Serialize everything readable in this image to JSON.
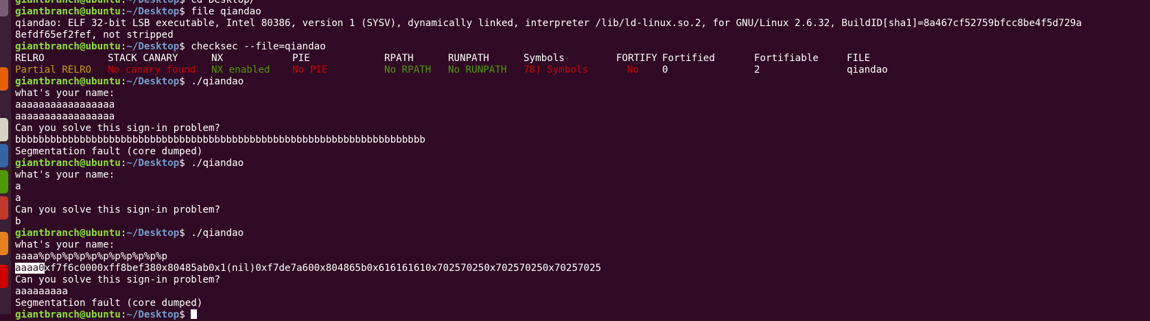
{
  "prompt": {
    "user": "giantbranch@ubuntu",
    "path": "~/Desktop"
  },
  "lines": [
    {
      "kind": "cmd",
      "text": "cd Desktop/"
    },
    {
      "kind": "cmd",
      "text": "file qiandao"
    },
    {
      "kind": "out",
      "text": "qiandao: ELF 32-bit LSB executable, Intel 80386, version 1 (SYSV), dynamically linked, interpreter /lib/ld-linux.so.2, for GNU/Linux 2.6.32, BuildID[sha1]=8a467cf52759bfcc8be4f5d729a"
    },
    {
      "kind": "out",
      "text": "8efdf65ef2fef, not stripped"
    },
    {
      "kind": "cmd",
      "text": "checksec --file=qiandao"
    }
  ],
  "checksec": {
    "headers": [
      "RELRO",
      "STACK CANARY",
      "NX",
      "PIE",
      "RPATH",
      "RUNPATH",
      "Symbols",
      "FORTIFY",
      "Fortified",
      "Fortifiable",
      "FILE"
    ],
    "values": [
      "Partial RELRO",
      "No canary found",
      "NX enabled",
      "No PIE",
      "No RPATH",
      "No RUNPATH",
      "78) Symbols",
      "No",
      "0",
      "2",
      "qiandao"
    ],
    "colors": [
      "#c4a000",
      "#cc0000",
      "#4e9a06",
      "#cc0000",
      "#4e9a06",
      "#4e9a06",
      "#cc0000",
      "#cc0000",
      "#ffffff",
      "#ffffff",
      "#ffffff"
    ]
  },
  "session": [
    {
      "kind": "cmd",
      "text": "./qiandao"
    },
    {
      "kind": "out",
      "text": "what's your name:"
    },
    {
      "kind": "out",
      "text": "aaaaaaaaaaaaaaaaa"
    },
    {
      "kind": "out",
      "text": "aaaaaaaaaaaaaaaaa"
    },
    {
      "kind": "out",
      "text": "Can you solve this sign-in problem?"
    },
    {
      "kind": "out",
      "text": "bbbbbbbbbbbbbbbbbbbbbbbbbbbbbbbbbbbbbbbbbbbbbbbbbbbbbbbbbbbbbbbbbbbbbb"
    },
    {
      "kind": "out",
      "text": "Segmentation fault (core dumped)"
    },
    {
      "kind": "cmd",
      "text": "./qiandao"
    },
    {
      "kind": "out",
      "text": "what's your name:"
    },
    {
      "kind": "out",
      "text": "a"
    },
    {
      "kind": "out",
      "text": "a"
    },
    {
      "kind": "out",
      "text": "Can you solve this sign-in problem?"
    },
    {
      "kind": "out",
      "text": "b"
    },
    {
      "kind": "cmd",
      "text": "./qiandao"
    },
    {
      "kind": "out",
      "text": "what's your name:"
    },
    {
      "kind": "out",
      "text": "aaaa%p%p%p%p%p%p%p%p%p%p%p"
    },
    {
      "kind": "leak",
      "highlight": "aaaa0",
      "text": "xf7f6c0000xff8bef380x80485ab0x1(nil)0xf7de7a600x804865b0x616161610x702570250x702570250x70257025"
    },
    {
      "kind": "out",
      "text": "Can you solve this sign-in problem?"
    },
    {
      "kind": "out",
      "text": "aaaaaaaaa"
    },
    {
      "kind": "out",
      "text": "Segmentation fault (core dumped)"
    },
    {
      "kind": "cmd",
      "text": ""
    }
  ],
  "launcher_icons": [
    {
      "name": "app-icon-1",
      "color": "#7a5a74"
    },
    {
      "name": "firefox-icon",
      "color": "#e66000"
    },
    {
      "name": "files-icon",
      "color": "#d8d2c4"
    },
    {
      "name": "writer-icon",
      "color": "#3465a4"
    },
    {
      "name": "calc-icon",
      "color": "#4e9a06"
    },
    {
      "name": "impress-icon",
      "color": "#c0392b"
    },
    {
      "name": "software-icon",
      "color": "#e67e22"
    },
    {
      "name": "amazon-icon",
      "color": "#cc0000"
    }
  ]
}
